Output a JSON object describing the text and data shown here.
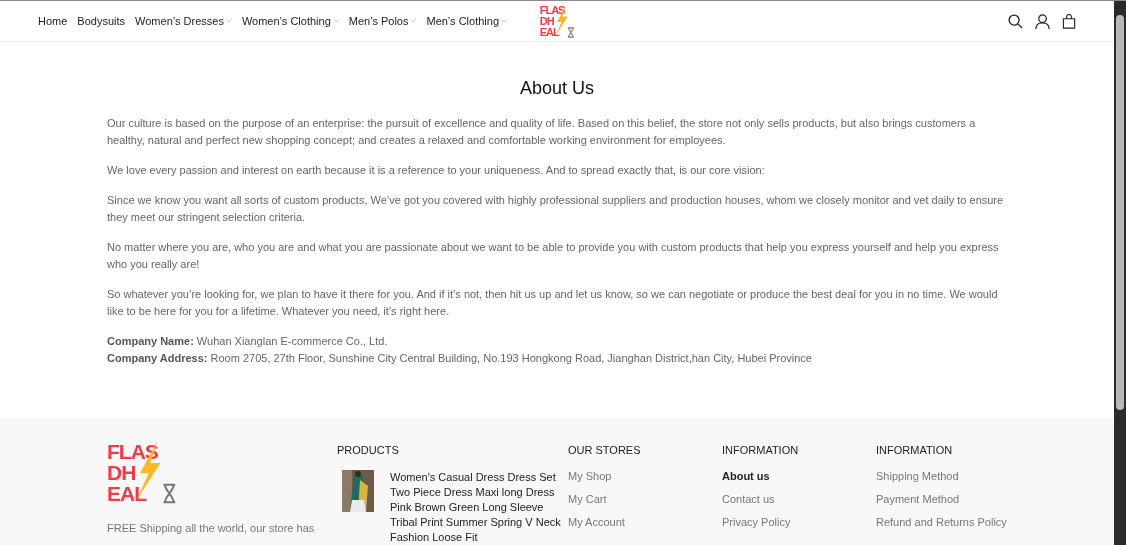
{
  "nav": {
    "items": [
      {
        "label": "Home",
        "dropdown": false
      },
      {
        "label": "Bodysuits",
        "dropdown": false
      },
      {
        "label": "Women’s Dresses",
        "dropdown": true
      },
      {
        "label": "Women’s Clothing",
        "dropdown": true
      },
      {
        "label": "Men’s Polos",
        "dropdown": true
      },
      {
        "label": "Men’s Clothing",
        "dropdown": true
      }
    ],
    "logo": [
      "FLAS",
      "DH",
      "EAL"
    ]
  },
  "about": {
    "title": "About Us",
    "paragraphs": [
      "Our culture is based on the purpose of an enterprise: the pursuit of excellence and quality of life. Based on this belief, the store not only sells products, but also brings customers a healthy, natural and perfect new shopping concept; and creates a relaxed and comfortable working environment for employees.",
      "We love every passion and interest on earth because it is a reference to your uniqueness. And to spread exactly that, is our core vision:",
      "Since we know you want all sorts of custom products, We’ve got you covered with highly professional suppliers and production houses, whom we closely monitor and vet daily to ensure they meet our stringent selection criteria.",
      "No matter where you are, who you are and what you are passionate about we want to be able to provide you with custom products that help you express yourself and help you express who you really are!",
      "So whatever you’re looking for, we plan to have it there for you. And if it’s not, then hit us up and let us know, so we can negotiate or produce the best deal for you in no time. We would like to be here for you for a lifetime. Whatever you need, it’s right here."
    ],
    "company": [
      "**Company Name:** Wuhan Xianglan E-commerce Co., Ltd.",
      "**Company Address:** Room 2705, 27th Floor, Sunshine City Central Building, No.193 Hongkong Road, Jianghan District,han City, Hubei Province"
    ]
  },
  "footer": {
    "logo": [
      "FLAS",
      "DH",
      "EAL"
    ],
    "tagline": "FREE Shipping all the world, our store has",
    "products": {
      "heading": "PRODUCTS",
      "items": [
        {
          "kind": "picture",
          "title": "Women's Casual Dress Dress Set Two Piece Dress Maxi long Dress Pink Brown Green Long Sleeve Tribal Print Summer Spring V Neck Fashion Loose Fit"
        }
      ]
    },
    "columns": [
      {
        "heading": "OUR STORES",
        "links": [
          {
            "label": "My Shop",
            "selected": false
          },
          {
            "label": "My Cart",
            "selected": false
          },
          {
            "label": "My Account",
            "selected": false
          }
        ]
      },
      {
        "heading": "INFORMATION",
        "links": [
          {
            "label": "About us",
            "selected": true
          },
          {
            "label": "Contact us",
            "selected": false
          },
          {
            "label": "Privacy Policy",
            "selected": false
          }
        ]
      },
      {
        "heading": "INFORMATION",
        "links": [
          {
            "label": "Shipping Method",
            "selected": false
          },
          {
            "label": "Payment Method",
            "selected": false
          },
          {
            "label": "Refund and Returns Policy",
            "selected": false
          }
        ]
      }
    ]
  }
}
